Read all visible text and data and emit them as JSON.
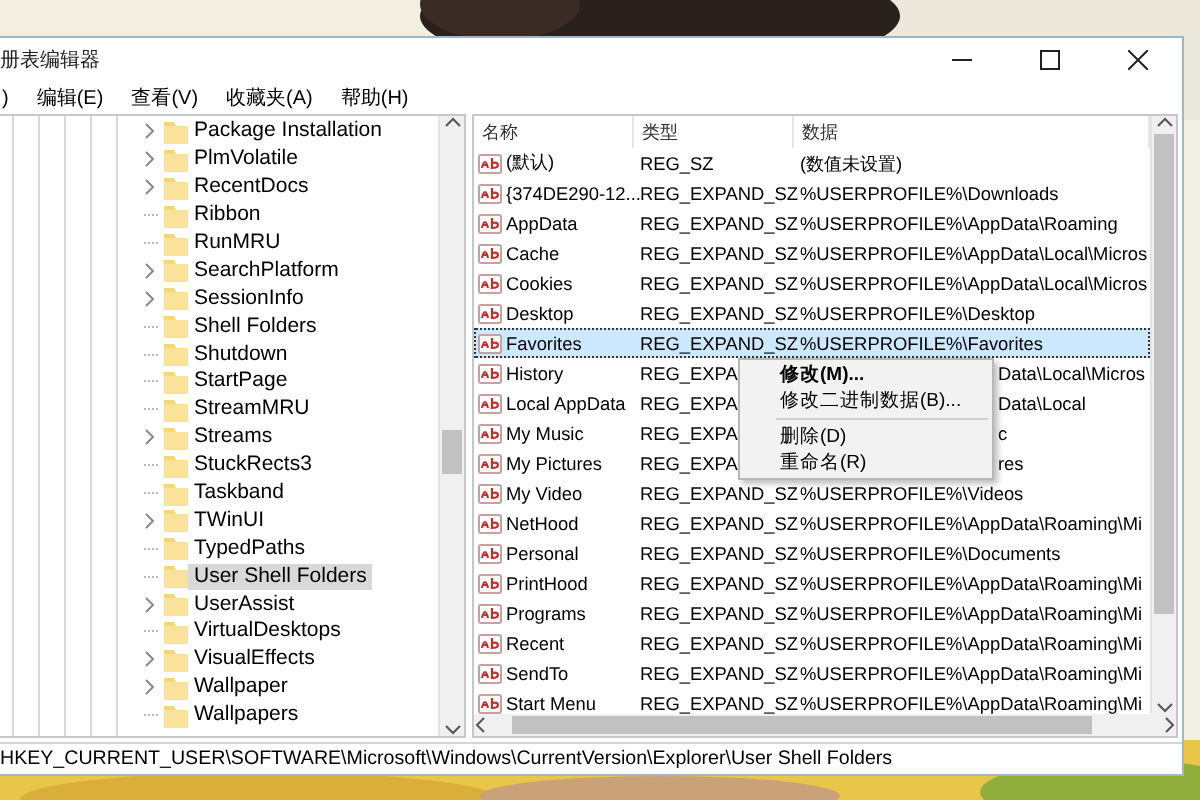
{
  "window": {
    "title": "册表编辑器"
  },
  "menu": [
    ")",
    "编辑(E)",
    "查看(V)",
    "收藏夹(A)",
    "帮助(H)"
  ],
  "tree": [
    {
      "label": "Package Installation",
      "expandable": true,
      "selected": false
    },
    {
      "label": "PlmVolatile",
      "expandable": true,
      "selected": false
    },
    {
      "label": "RecentDocs",
      "expandable": true,
      "selected": false
    },
    {
      "label": "Ribbon",
      "expandable": false,
      "selected": false
    },
    {
      "label": "RunMRU",
      "expandable": false,
      "selected": false
    },
    {
      "label": "SearchPlatform",
      "expandable": true,
      "selected": false
    },
    {
      "label": "SessionInfo",
      "expandable": true,
      "selected": false
    },
    {
      "label": "Shell Folders",
      "expandable": false,
      "selected": false
    },
    {
      "label": "Shutdown",
      "expandable": false,
      "selected": false
    },
    {
      "label": "StartPage",
      "expandable": false,
      "selected": false
    },
    {
      "label": "StreamMRU",
      "expandable": false,
      "selected": false
    },
    {
      "label": "Streams",
      "expandable": true,
      "selected": false
    },
    {
      "label": "StuckRects3",
      "expandable": false,
      "selected": false
    },
    {
      "label": "Taskband",
      "expandable": false,
      "selected": false
    },
    {
      "label": "TWinUI",
      "expandable": true,
      "selected": false
    },
    {
      "label": "TypedPaths",
      "expandable": false,
      "selected": false
    },
    {
      "label": "User Shell Folders",
      "expandable": false,
      "selected": true
    },
    {
      "label": "UserAssist",
      "expandable": true,
      "selected": false
    },
    {
      "label": "VirtualDesktops",
      "expandable": false,
      "selected": false
    },
    {
      "label": "VisualEffects",
      "expandable": true,
      "selected": false
    },
    {
      "label": "Wallpaper",
      "expandable": true,
      "selected": false
    },
    {
      "label": "Wallpapers",
      "expandable": false,
      "selected": false
    }
  ],
  "list": {
    "columns": [
      "名称",
      "类型",
      "数据"
    ],
    "rows": [
      {
        "name": "(默认)",
        "type": "REG_SZ",
        "data": "(数值未设置)",
        "selected": false,
        "partly_hidden": false
      },
      {
        "name": "{374DE290-12...",
        "type": "REG_EXPAND_SZ",
        "data": "%USERPROFILE%\\Downloads",
        "selected": false,
        "partly_hidden": false
      },
      {
        "name": "AppData",
        "type": "REG_EXPAND_SZ",
        "data": "%USERPROFILE%\\AppData\\Roaming",
        "selected": false,
        "partly_hidden": false
      },
      {
        "name": "Cache",
        "type": "REG_EXPAND_SZ",
        "data": "%USERPROFILE%\\AppData\\Local\\Micros",
        "selected": false,
        "partly_hidden": false
      },
      {
        "name": "Cookies",
        "type": "REG_EXPAND_SZ",
        "data": "%USERPROFILE%\\AppData\\Local\\Micros",
        "selected": false,
        "partly_hidden": false
      },
      {
        "name": "Desktop",
        "type": "REG_EXPAND_SZ",
        "data": "%USERPROFILE%\\Desktop",
        "selected": false,
        "partly_hidden": false
      },
      {
        "name": "Favorites",
        "type": "REG_EXPAND_SZ",
        "data": "%USERPROFILE%\\Favorites",
        "selected": true,
        "partly_hidden": false
      },
      {
        "name": "History",
        "type": "REG_EXPA",
        "data": "Data\\Local\\Micros",
        "selected": false,
        "partly_hidden": true
      },
      {
        "name": "Local AppData",
        "type": "REG_EXPA",
        "data": "Data\\Local",
        "selected": false,
        "partly_hidden": true
      },
      {
        "name": "My Music",
        "type": "REG_EXPA",
        "data": "c",
        "selected": false,
        "partly_hidden": true
      },
      {
        "name": "My Pictures",
        "type": "REG_EXPA",
        "data": "res",
        "selected": false,
        "partly_hidden": true
      },
      {
        "name": "My Video",
        "type": "REG_EXPAND_SZ",
        "data": "%USERPROFILE%\\Videos",
        "selected": false,
        "partly_hidden": false
      },
      {
        "name": "NetHood",
        "type": "REG_EXPAND_SZ",
        "data": "%USERPROFILE%\\AppData\\Roaming\\Mi",
        "selected": false,
        "partly_hidden": false
      },
      {
        "name": "Personal",
        "type": "REG_EXPAND_SZ",
        "data": "%USERPROFILE%\\Documents",
        "selected": false,
        "partly_hidden": false
      },
      {
        "name": "PrintHood",
        "type": "REG_EXPAND_SZ",
        "data": "%USERPROFILE%\\AppData\\Roaming\\Mi",
        "selected": false,
        "partly_hidden": false
      },
      {
        "name": "Programs",
        "type": "REG_EXPAND_SZ",
        "data": "%USERPROFILE%\\AppData\\Roaming\\Mi",
        "selected": false,
        "partly_hidden": false
      },
      {
        "name": "Recent",
        "type": "REG_EXPAND_SZ",
        "data": "%USERPROFILE%\\AppData\\Roaming\\Mi",
        "selected": false,
        "partly_hidden": false
      },
      {
        "name": "SendTo",
        "type": "REG_EXPAND_SZ",
        "data": "%USERPROFILE%\\AppData\\Roaming\\Mi",
        "selected": false,
        "partly_hidden": false
      },
      {
        "name": "Start Menu",
        "type": "REG_EXPAND_SZ",
        "data": "%USERPROFILE%\\AppData\\Roaming\\Mi",
        "selected": false,
        "partly_hidden": false
      }
    ]
  },
  "context_menu": {
    "items": [
      {
        "kind": "item",
        "label": "修改(M)...",
        "default": true
      },
      {
        "kind": "item",
        "label": "修改二进制数据(B)...",
        "default": false
      },
      {
        "kind": "separator"
      },
      {
        "kind": "item",
        "label": "删除(D)",
        "default": false
      },
      {
        "kind": "item",
        "label": "重命名(R)",
        "default": false
      }
    ]
  },
  "status_bar": "HKEY_CURRENT_USER\\SOFTWARE\\Microsoft\\Windows\\CurrentVersion\\Explorer\\User Shell Folders"
}
